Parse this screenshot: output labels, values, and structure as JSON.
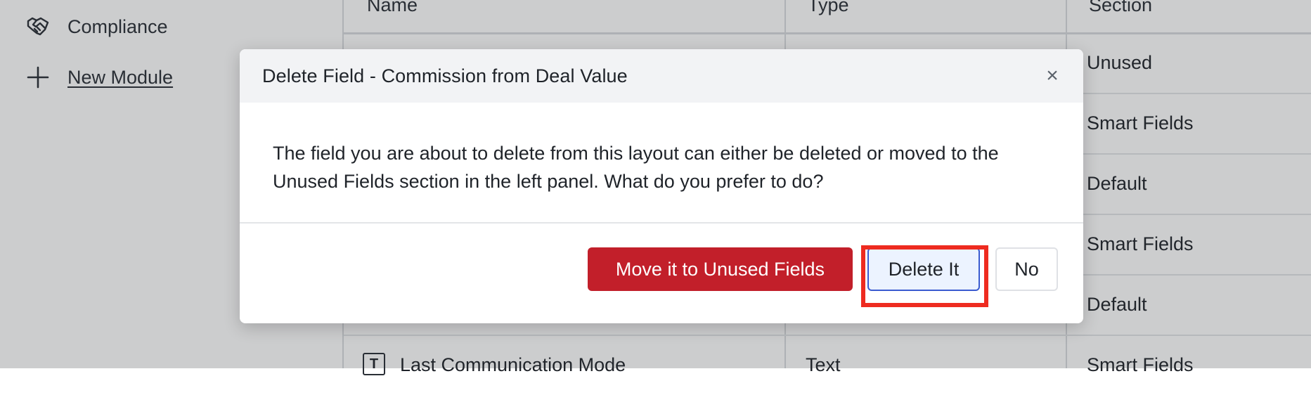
{
  "sidebar": {
    "items": [
      {
        "label": "Compliance",
        "icon": "handshake-icon"
      },
      {
        "label": "New Module",
        "icon": "plus-icon"
      }
    ]
  },
  "table": {
    "headers": [
      "Name",
      "Type",
      "Section"
    ],
    "rows": [
      {
        "section": "Unused"
      },
      {
        "section": "Smart Fields"
      },
      {
        "section": "Default"
      },
      {
        "section": "Smart Fields"
      },
      {
        "section": "Default"
      },
      {
        "name": "Last Communication Mode",
        "type": "Text",
        "section": "Smart Fields",
        "icon": "text-field-icon"
      }
    ]
  },
  "modal": {
    "title": "Delete Field - Commission from Deal Value",
    "close_icon": "close-icon",
    "body": "The field you are about to delete from this layout can either be deleted or moved to the Unused Fields section in the left panel. What do you prefer to do?",
    "buttons": {
      "move": "Move it to Unused Fields",
      "delete": "Delete It",
      "no": "No"
    }
  },
  "colors": {
    "danger": "#c21f2a",
    "highlight": "#ee2b20",
    "selected_border": "#3a5bd0"
  }
}
